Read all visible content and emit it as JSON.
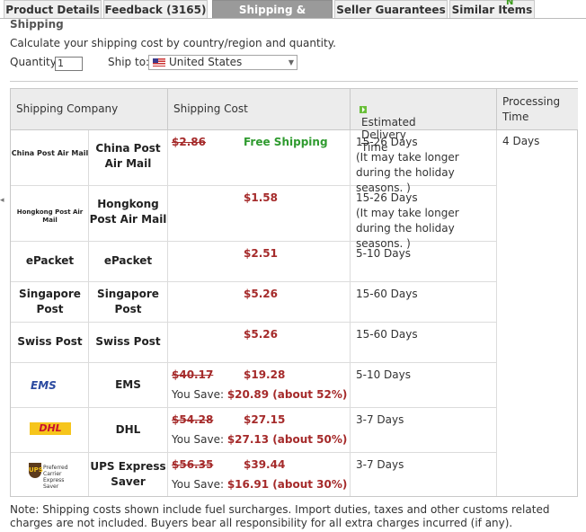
{
  "tabs": [
    {
      "label": "Product Details"
    },
    {
      "label": "Feedback (3165)"
    },
    {
      "label": "Shipping & Payment"
    },
    {
      "label": "Seller Guarantees"
    },
    {
      "label": "Similar Items"
    }
  ],
  "badge": "N",
  "section_title": "Shipping",
  "calc_text": "Calculate your shipping cost by country/region and quantity.",
  "quantity": {
    "label": "Quantity:",
    "value": "1"
  },
  "ship_to": {
    "label": "Ship to:",
    "value": "United States"
  },
  "headers": {
    "company": "Shipping Company",
    "cost": "Shipping Cost",
    "delivery": "Estimated Delivery Time",
    "processing": "Processing Time"
  },
  "processing_time": "4 Days",
  "rows": [
    {
      "logo": "China Post Air Mail",
      "name": "China Post Air Mail",
      "old": "$2.86",
      "price": "",
      "free": "Free Shipping",
      "save_label": "",
      "save": "",
      "delivery": "15-26 Days",
      "delivery_note": "(It may take longer during the holiday seasons. )"
    },
    {
      "logo": "Hongkong Post Air Mail",
      "name": "Hongkong Post Air Mail",
      "old": "",
      "price": "$1.58",
      "free": "",
      "save_label": "",
      "save": "",
      "delivery": "15-26 Days",
      "delivery_note": "(It may take longer during the holiday seasons. )"
    },
    {
      "logo": "ePacket",
      "name": "ePacket",
      "old": "",
      "price": "$2.51",
      "free": "",
      "save_label": "",
      "save": "",
      "delivery": "5-10 Days",
      "delivery_note": ""
    },
    {
      "logo": "Singapore Post",
      "name": "Singapore Post",
      "old": "",
      "price": "$5.26",
      "free": "",
      "save_label": "",
      "save": "",
      "delivery": "15-60 Days",
      "delivery_note": ""
    },
    {
      "logo": "Swiss Post",
      "name": "Swiss Post",
      "old": "",
      "price": "$5.26",
      "free": "",
      "save_label": "",
      "save": "",
      "delivery": "15-60 Days",
      "delivery_note": ""
    },
    {
      "logo": "EMS",
      "name": "EMS",
      "old": "$40.17",
      "price": "$19.28",
      "free": "",
      "save_label": "You Save: ",
      "save": "$20.89 (about 52%)",
      "delivery": "5-10 Days",
      "delivery_note": ""
    },
    {
      "logo": "DHL",
      "name": "DHL",
      "old": "$54.28",
      "price": "$27.15",
      "free": "",
      "save_label": "You Save: ",
      "save": "$27.13 (about 50%)",
      "delivery": "3-7 Days",
      "delivery_note": ""
    },
    {
      "logo": "UPS",
      "logo_text": "Preferred Carrier Express Saver",
      "name": "UPS Express Saver",
      "old": "$56.35",
      "price": "$39.44",
      "free": "",
      "save_label": "You Save: ",
      "save": "$16.91 (about 30%)",
      "delivery": "3-7 Days",
      "delivery_note": ""
    }
  ],
  "note": "Note: Shipping costs shown include fuel surcharges. Import duties, taxes and other customs related charges are not included. Buyers bear all responsibility for all extra charges incurred (if any).",
  "colors": {
    "price": "#a52a2a",
    "free": "#2f9b2f",
    "active_tab": "#9a9a9a",
    "header_bg": "#ececec"
  }
}
